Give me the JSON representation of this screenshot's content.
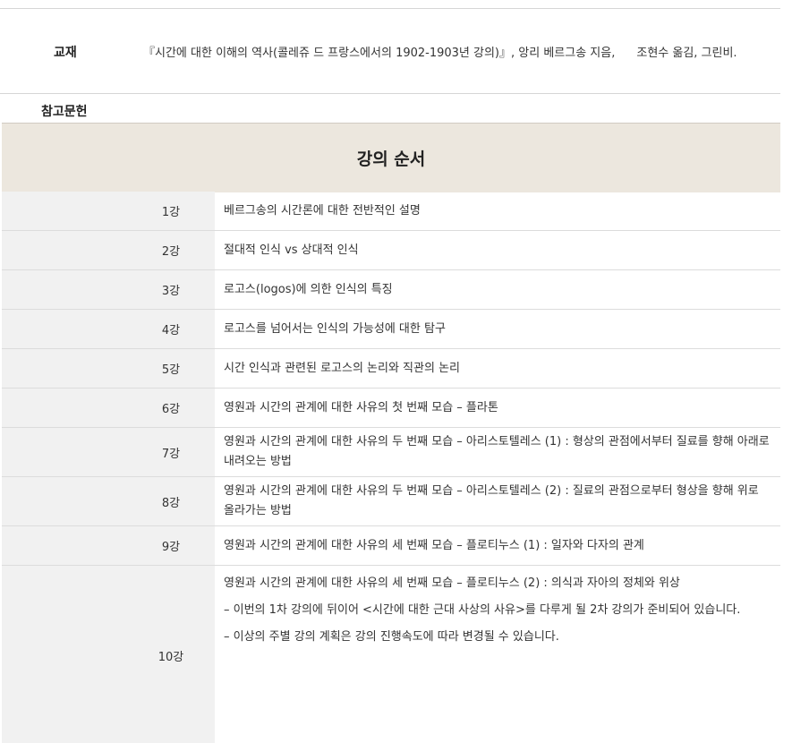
{
  "course_info": {
    "textbook_label": "교재",
    "textbook_value": "『시간에 대한 이해의 역사(콜레쥬 드 프랑스에서의 1902-1903년 강의)』, 앙리 베르그송 지음,",
    "textbook_translator": "조현수 옮김, 그린비.",
    "references_label": "참고문헌"
  },
  "schedule": {
    "title": "강의 순서",
    "lectures": [
      {
        "num": "1강",
        "desc": "베르그송의 시간론에 대한 전반적인 설명"
      },
      {
        "num": "2강",
        "desc": "절대적 인식 vs 상대적 인식"
      },
      {
        "num": "3강",
        "desc": "로고스(logos)에 의한 인식의 특징"
      },
      {
        "num": "4강",
        "desc": "로고스를 넘어서는 인식의 가능성에 대한 탐구"
      },
      {
        "num": "5강",
        "desc": "시간 인식과 관련된 로고스의 논리와 직관의 논리"
      },
      {
        "num": "6강",
        "desc": "영원과 시간의 관계에 대한 사유의 첫 번째 모습 – 플라톤"
      },
      {
        "num": "7강",
        "desc": "영원과 시간의 관계에 대한 사유의 두 번째 모습 – 아리스토텔레스 (1) : 형상의 관점에서부터 질료를 향해 아래로 내려오는 방법"
      },
      {
        "num": "8강",
        "desc": "영원과 시간의 관계에 대한 사유의 두 번째 모습 – 아리스토텔레스 (2) : 질료의 관점으로부터 형상을 향해 위로 올라가는 방법"
      },
      {
        "num": "9강",
        "desc": "영원과 시간의 관계에 대한 사유의 세 번째 모습 – 플로티누스 (1) : 일자와 다자의 관계"
      },
      {
        "num": "10강",
        "desc": "영원과 시간의 관계에 대한 사유의 세 번째 모습 – 플로티누스 (2) : 의식과 자아의 정체와 위상"
      }
    ],
    "notes": [
      "– 이번의 1차 강의에 뒤이어 <시간에 대한 근대 사상의 사유>를 다루게 될 2차 강의가 준비되어 있습니다.",
      "– 이상의 주별 강의 계획은 강의 진행속도에 따라 변경될 수 있습니다."
    ]
  }
}
